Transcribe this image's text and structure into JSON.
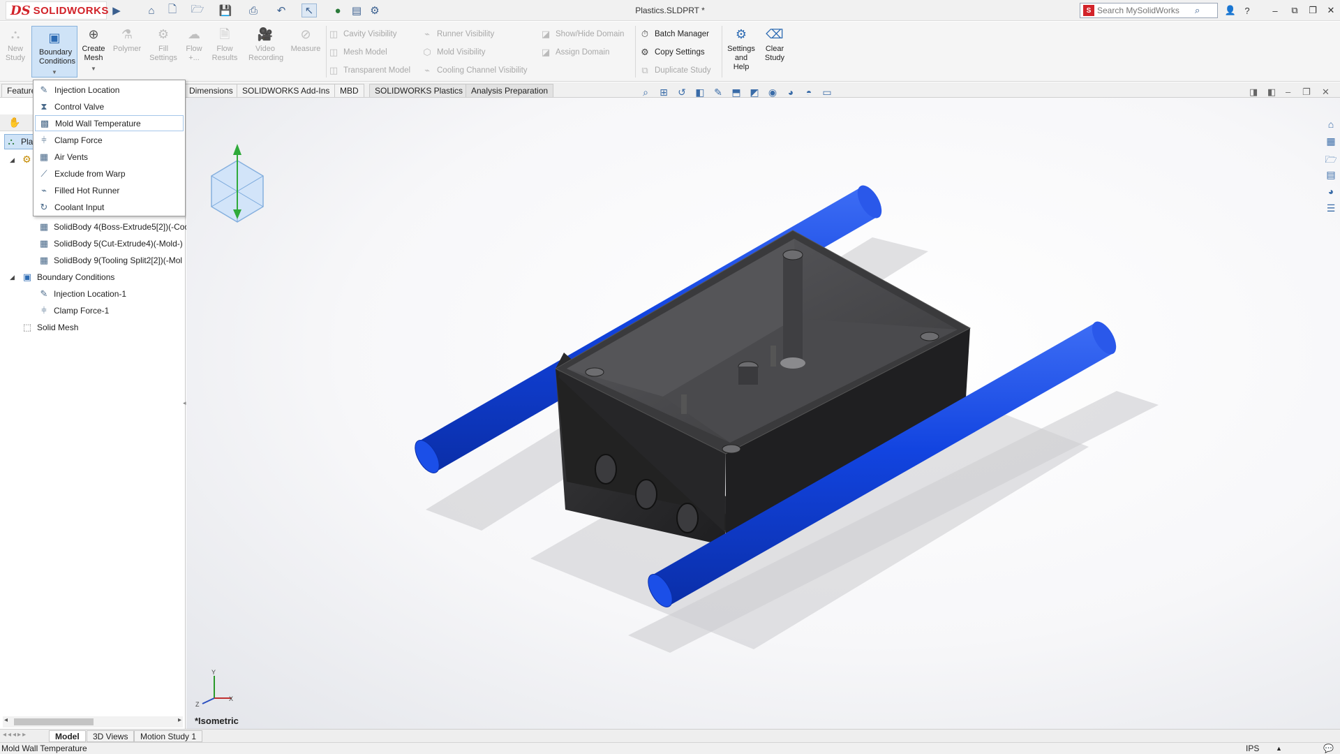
{
  "app": {
    "logo_ds": "DS",
    "logo_word": "SOLIDWORKS",
    "document_title": "Plastics.SLDPRT *",
    "search_placeholder": "Search MySolidWorks"
  },
  "toolbar": {
    "new_study": "New\nStudy",
    "boundary_conditions": "Boundary\nConditions",
    "create_mesh": "Create\nMesh",
    "polymer": "Polymer",
    "fill_settings": "Fill\nSettings",
    "flow": "Flow\n+...",
    "flow_results": "Flow\nResults",
    "video_recording": "Video\nRecording",
    "measure": "Measure",
    "cavity_visibility": "Cavity Visibility",
    "mesh_model": "Mesh Model",
    "transparent_model": "Transparent Model",
    "runner_visibility": "Runner Visibility",
    "mold_visibility": "Mold Visibility",
    "cooling_channel_visibility": "Cooling Channel Visibility",
    "show_hide_domain": "Show/Hide Domain",
    "assign_domain": "Assign Domain",
    "batch_manager": "Batch Manager",
    "copy_settings": "Copy Settings",
    "duplicate_study": "Duplicate Study",
    "settings_and_help": "Settings\nand\nHelp",
    "clear_study": "Clear\nStudy"
  },
  "tabs": [
    "Features",
    "Dimensions",
    "SOLIDWORKS Add-Ins",
    "MBD",
    "SOLIDWORKS Plastics",
    "Analysis Preparation"
  ],
  "dropdown": {
    "items": [
      {
        "label": "Injection Location",
        "icon": "injection-icon"
      },
      {
        "label": "Control Valve",
        "icon": "valve-icon"
      },
      {
        "label": "Mold Wall Temperature",
        "icon": "temperature-icon"
      },
      {
        "label": "Clamp Force",
        "icon": "clamp-icon"
      },
      {
        "label": "Air Vents",
        "icon": "vent-icon"
      },
      {
        "label": "Exclude from Warp",
        "icon": "warp-icon"
      },
      {
        "label": "Filled Hot Runner",
        "icon": "runner-icon"
      },
      {
        "label": "Coolant Input",
        "icon": "coolant-icon"
      }
    ]
  },
  "tree": {
    "root_label": "Pla",
    "items": [
      {
        "label": "SolidBody 4(Boss-Extrude5[2])(-Coo"
      },
      {
        "label": "SolidBody 5(Cut-Extrude4)(-Mold-)"
      },
      {
        "label": "SolidBody 9(Tooling Split2[2])(-Mol"
      },
      {
        "label": "Boundary Conditions"
      },
      {
        "label": "Injection Location-1"
      },
      {
        "label": "Clamp Force-1"
      },
      {
        "label": "Solid Mesh"
      }
    ]
  },
  "viewport": {
    "view_name": "*Isometric",
    "axis_y": "Y",
    "axis_x": "X",
    "axis_z": "Z"
  },
  "bottom_tabs": [
    "Model",
    "3D Views",
    "Motion Study 1"
  ],
  "status": {
    "text": "Mold Wall Temperature",
    "units": "IPS"
  },
  "colors": {
    "accent_red": "#d2232a",
    "selection_blue": "#cfe3f7",
    "channel_blue": "#1244e0",
    "part_dark": "#2c2c2e"
  }
}
